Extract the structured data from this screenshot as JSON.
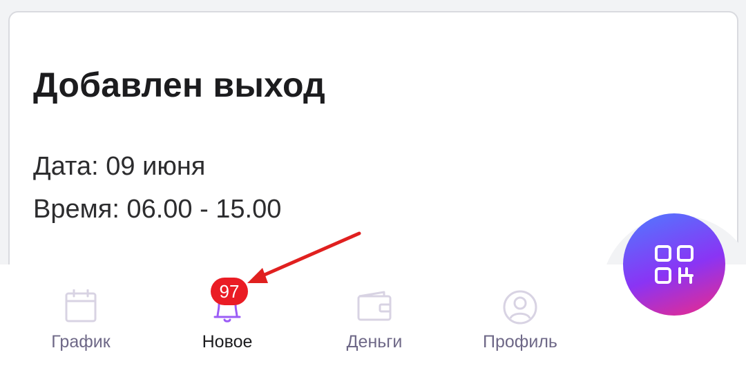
{
  "card": {
    "title": "Добавлен выход",
    "date_line": "Дата: 09 июня",
    "time_line": "Время: 06.00 - 15.00"
  },
  "nav": {
    "items": [
      {
        "label": "График",
        "icon": "calendar-icon",
        "active": false
      },
      {
        "label": "Новое",
        "icon": "bell-icon",
        "active": true
      },
      {
        "label": "Деньги",
        "icon": "wallet-icon",
        "active": false
      },
      {
        "label": "Профиль",
        "icon": "profile-icon",
        "active": false
      }
    ],
    "badge_count": "97"
  },
  "fab": {
    "icon": "qr-code-icon"
  },
  "colors": {
    "accent": "#9b5cf6",
    "badge": "#ea1c24",
    "annotation_arrow": "#e0201f",
    "inactive_icon": "#d8d3e3",
    "inactive_label": "#6e6887"
  }
}
